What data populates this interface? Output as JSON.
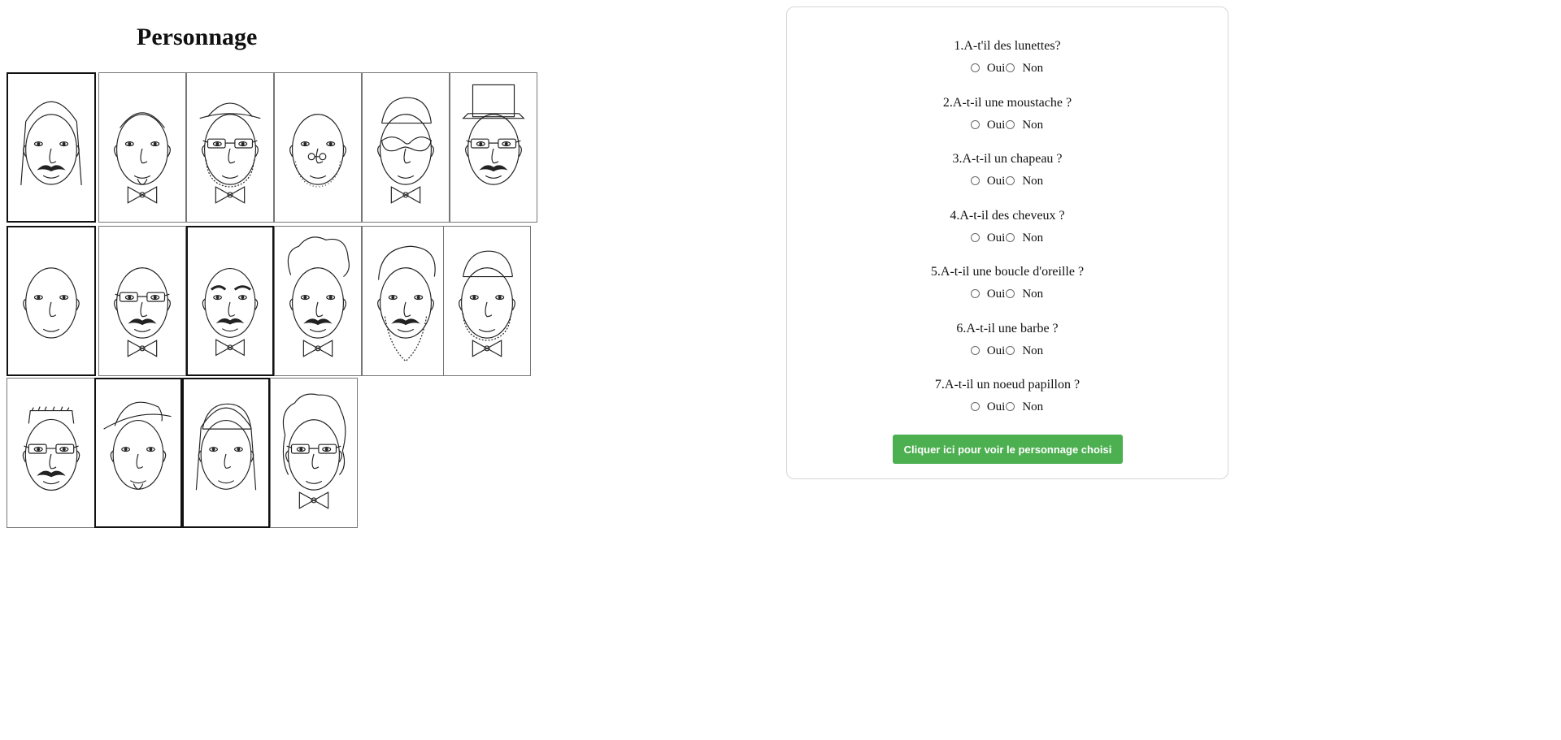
{
  "left": {
    "title": "Personnage",
    "characters": [
      {
        "icon": "face-long-hair-mustache-icon"
      },
      {
        "icon": "face-bowtie-beard-icon"
      },
      {
        "icon": "face-hat-glasses-beard-icon"
      },
      {
        "icon": "face-bald-beard-icon"
      },
      {
        "icon": "face-mask-bowtie-icon"
      },
      {
        "icon": "face-top-hat-glasses-icon"
      },
      {
        "icon": "face-plain-icon"
      },
      {
        "icon": "face-glasses-bowtie-icon"
      },
      {
        "icon": "face-mustache-bowtie-icon"
      },
      {
        "icon": "face-chef-hat-mustache-icon"
      },
      {
        "icon": "face-beret-beard-icon"
      },
      {
        "icon": "face-cap-beard-bowtie-icon"
      },
      {
        "icon": "face-hair-glasses-mustache-icon"
      },
      {
        "icon": "face-bowler-hat-icon"
      },
      {
        "icon": "face-cap-woman-icon"
      },
      {
        "icon": "face-curly-hair-glasses-bowtie-icon"
      }
    ]
  },
  "form": {
    "questions": [
      {
        "label": "1.A-t'il des lunettes?",
        "yes": "Oui",
        "no": "Non"
      },
      {
        "label": "2.A-t-il une moustache ?",
        "yes": "Oui",
        "no": "Non"
      },
      {
        "label": "3.A-t-il un chapeau ?",
        "yes": "Oui",
        "no": "Non"
      },
      {
        "label": "4.A-t-il des cheveux ?",
        "yes": "Oui",
        "no": "Non"
      },
      {
        "label": "5.A-t-il une boucle d'oreille ?",
        "yes": "Oui",
        "no": "Non"
      },
      {
        "label": "6.A-t-il une barbe ?",
        "yes": "Oui",
        "no": "Non"
      },
      {
        "label": "7.A-t-il un noeud papillon ?",
        "yes": "Oui",
        "no": "Non"
      }
    ],
    "submit_label": "Cliquer ici pour voir le personnage choisi",
    "accent_color": "#4caf50"
  }
}
